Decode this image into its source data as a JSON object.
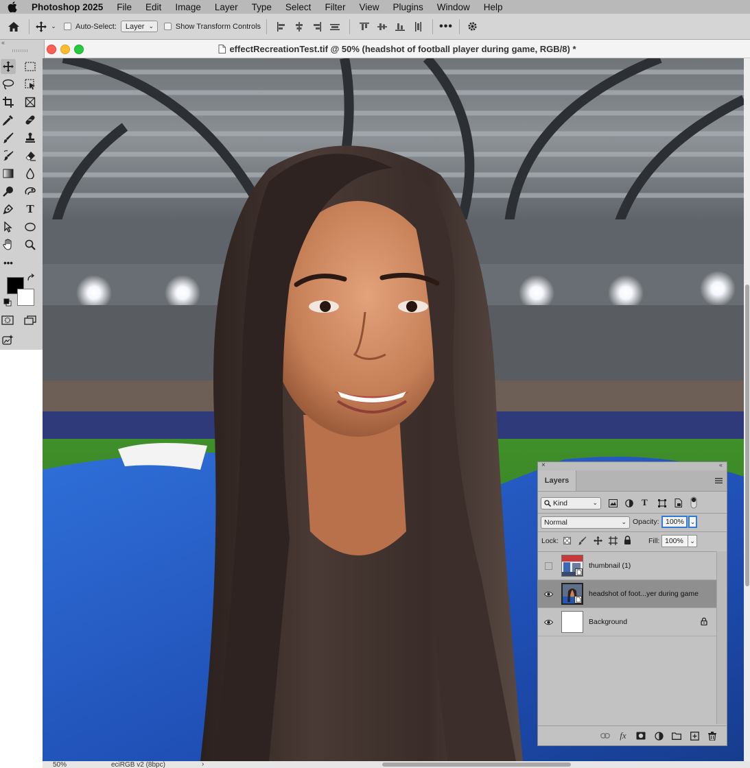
{
  "menubar": {
    "app_name": "Photoshop 2025",
    "items": [
      "File",
      "Edit",
      "Image",
      "Layer",
      "Type",
      "Select",
      "Filter",
      "View",
      "Plugins",
      "Window",
      "Help"
    ]
  },
  "options_bar": {
    "auto_select_label": "Auto-Select:",
    "auto_select_value": "Layer",
    "show_transform_label": "Show Transform Controls"
  },
  "document": {
    "title": "effectRecreationTest.tif @ 50% (headshot of football player during game, RGB/8) *"
  },
  "status_bar": {
    "zoom": "50%",
    "profile": "eciRGB v2 (8bpc)"
  },
  "layers_panel": {
    "tab_label": "Layers",
    "filter_kind": "Kind",
    "blend_mode": "Normal",
    "opacity_label": "Opacity:",
    "opacity_value": "100%",
    "lock_label": "Lock:",
    "fill_label": "Fill:",
    "fill_value": "100%",
    "layers": [
      {
        "name": "thumbnail (1)",
        "visible": false
      },
      {
        "name": "headshot of foot...yer during game",
        "visible": true,
        "selected": true
      },
      {
        "name": "Background",
        "visible": true,
        "locked": true
      }
    ]
  },
  "colors": {
    "menubar_bg": "#b9b9b9",
    "panel_bg": "#c2c2c2",
    "close": "#ff5f57",
    "minimize": "#febc2e",
    "zoom": "#28c840",
    "selection_outline": "#2f7bd6"
  },
  "icons": {
    "tools": [
      "move-icon",
      "marquee-icon",
      "lasso-icon",
      "object-select-icon",
      "crop-icon",
      "frame-icon",
      "eyedropper-icon",
      "healing-icon",
      "brush-icon",
      "stamp-icon",
      "history-brush-icon",
      "eraser-icon",
      "gradient-icon",
      "blur-icon",
      "dodge-icon",
      "smudge-icon",
      "pen-icon",
      "type-icon",
      "path-select-icon",
      "ellipse-icon",
      "hand-icon",
      "zoom-icon"
    ]
  }
}
